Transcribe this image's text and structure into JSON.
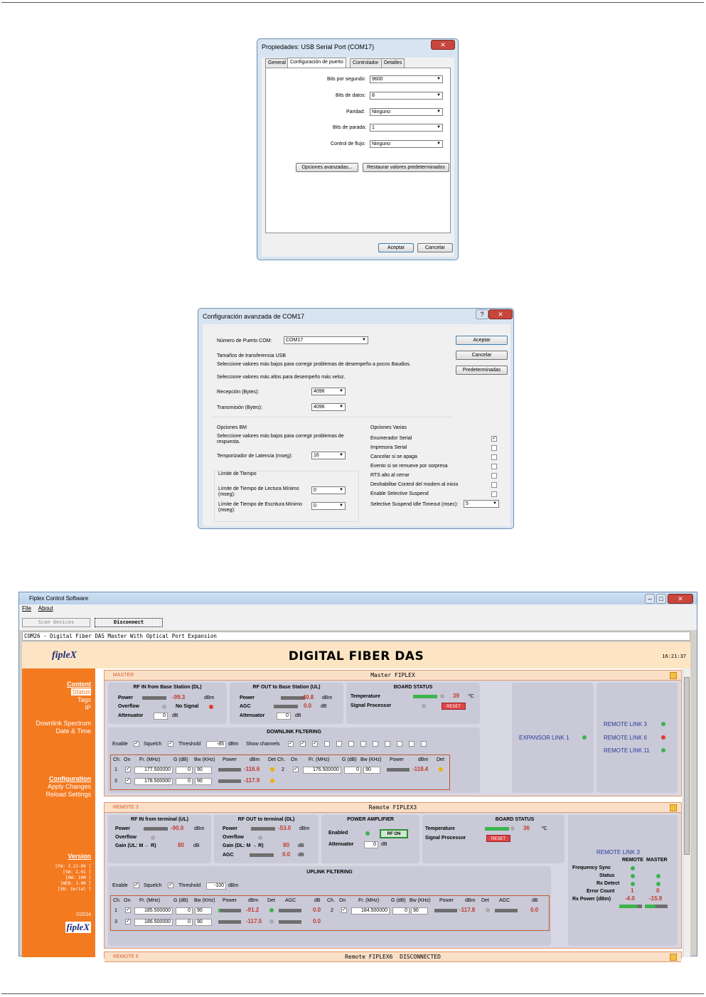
{
  "dialog1": {
    "title": "Propiedades: USB Serial Port (COM17)",
    "tabs": [
      "General",
      "Configuración de puerto",
      "Controlador",
      "Detalles"
    ],
    "fields": [
      {
        "label": "Bits por segundo:",
        "value": "9600"
      },
      {
        "label": "Bits de datos:",
        "value": "8"
      },
      {
        "label": "Paridad:",
        "value": "Ninguno"
      },
      {
        "label": "Bits de parada:",
        "value": "1"
      },
      {
        "label": "Control de flujo:",
        "value": "Ninguno"
      }
    ],
    "advanced_button": "Opciones avanzadas...",
    "restore_button": "Restaurar valores predeterminados",
    "accept_button": "Aceptar",
    "cancel_button": "Cancelar"
  },
  "dialog2": {
    "title": "Configuración avanzada de COM17",
    "com_label": "Número de Puerto COM:",
    "com_value": "COM17",
    "usb_group": "Tamaños de transferencia USB",
    "usb_note1": "Seleccione valores más bajos para corregir problemas de desempeño a pocos Baudios.",
    "usb_note2": "Seleccione valores más altos para desempeño más veloz.",
    "rx_label": "Recepción (Bytes):",
    "rx_value": "4096",
    "tx_label": "Transmisión (Bytes):",
    "tx_value": "4096",
    "bm_group": "Opciones BM",
    "bm_note": "Seleccione valores más bajos para corregir problemas de respuesta.",
    "latency_label": "Temporizador de Latencia (mseg):",
    "latency_value": "16",
    "timeouts_group": "Límite de Tiempo",
    "read_timeout_label": "Límite de Tiempo de Lectura Mínimo (mseg):",
    "read_timeout_value": "0",
    "write_timeout_label": "Límite de Tiempo de Escritura Mínimo (mseg):",
    "write_timeout_value": "0",
    "misc_group": "Opciones Varias",
    "misc_options": [
      {
        "label": "Enumerador Serial",
        "checked": "✓"
      },
      {
        "label": "Impresora Serial",
        "checked": ""
      },
      {
        "label": "Cancelar si se apaga",
        "checked": ""
      },
      {
        "label": "Evento si se remueve por sorpresa",
        "checked": ""
      },
      {
        "label": "RTS alto al cerrar",
        "checked": ""
      },
      {
        "label": "Deshabilitar Control del modem al inicio",
        "checked": ""
      },
      {
        "label": "Enable Selective Suspend",
        "checked": ""
      }
    ],
    "suspend_label": "Selective Suspend Idle Timeout (msec):",
    "suspend_value": "5",
    "accept_button": "Aceptar",
    "cancel_button": "Cancelar",
    "defaults_button": "Predeterminadas"
  },
  "app": {
    "title": "Fiplex Control Software",
    "menu": [
      "File",
      "About"
    ],
    "scan_button": "Scan devices",
    "disconnect_button": "Disconnect",
    "device": "COM26 - Digital Fiber DAS Master With Optical Port Expansion",
    "logo": "fipleX",
    "heading": "DIGITAL FIBER DAS",
    "clock": "16:21:37",
    "sidebar": {
      "content": "Content",
      "status": "Status",
      "tags": "Tags",
      "ip": "IP",
      "spectrum": "Downlink Spectrum",
      "datetime": "Date & Time",
      "configuration": "Configuration",
      "apply": "Apply Changes",
      "reload": "Reload Settings",
      "version": "Version",
      "fw": "[FW: 3.12-00 ]",
      "sw": "[SW: 2.01 ]",
      "hw": "[HW: 10M ]",
      "web": "[WEB: 1.00 ]",
      "sn": "[SN: Serial ]",
      "copyright": "©2014"
    },
    "master": {
      "tag": "MASTER",
      "title": "Master FIPLEX",
      "rfin_title": "RF IN from Base Station (DL)",
      "rfin_power_label": "Power",
      "rfin_power": "-99.3",
      "dbm": "dBm",
      "db": "dB",
      "overflow_label": "Overflow",
      "nosignal_label": "No Signal",
      "attenuator_label": "Attenuator",
      "attenuator_value": "0",
      "rfout_title": "RF OUT to Base Station (UL)",
      "rfout_power": "-40.8",
      "agc_label": "AGC",
      "agc_value": "0.0",
      "rfout_att": "0",
      "board_title": "BOARD STATUS",
      "temp_label": "Temperature",
      "temp_value": "39",
      "temp_unit": "ºC",
      "sp_label": "Signal Processor",
      "reset": "RESET",
      "dlf_title": "DOWNLINK FILTERING",
      "enable_label": "Enable",
      "squelch_label": "Squelch",
      "threshold_label": "Threshold",
      "threshold_value": "-85",
      "showch_label": "Show channels",
      "col_headers": [
        "Ch.",
        "On",
        "Fr. (MHz)",
        "G (dB)",
        "Bw (KHz)",
        "Power",
        "dBm",
        "Det"
      ],
      "channels": [
        {
          "ch": "1",
          "fr": "177.500000",
          "g": "0",
          "bw": "90",
          "p": "-116.6"
        },
        {
          "ch": "2",
          "fr": "176.500000",
          "g": "0",
          "bw": "90",
          "p": "-118.4"
        },
        {
          "ch": "3",
          "fr": "178.500000",
          "g": "0",
          "bw": "90",
          "p": "-117.9"
        }
      ],
      "expansor": "EXPANSOR LINK 1",
      "remote_links": [
        "REMOTE LINK 3",
        "REMOTE LINK 6",
        "REMOTE LINK 11"
      ]
    },
    "remote3": {
      "tag": "REMOTE 3",
      "title": "Remote FIPLEX3",
      "rfin_title": "RF IN from terminal (UL)",
      "power": "-90.0",
      "overflow": "Overflow",
      "gain_label": "Gain (UL: M ← R)",
      "gain": "80",
      "rfout_title": "RF OUT to terminal (DL)",
      "rfout_power": "-53.0",
      "gain2_label": "Gain (DL: M → R)",
      "gain2": "80",
      "agc": "0.0",
      "pa_title": "POWER AMPLIFIER",
      "enabled_label": "Enabled",
      "rf_on": "RF ON",
      "att_value": "0",
      "board_title": "BOARD STATUS",
      "temp": "36",
      "ulf_title": "UPLINK FILTERING",
      "threshold": "-100",
      "col_headers": [
        "Ch.",
        "On",
        "Fr. (MHz)",
        "G (dB)",
        "Bw (KHz)",
        "Power",
        "dBm",
        "Det",
        "AGC",
        "dB"
      ],
      "channels": [
        {
          "ch": "1",
          "fr": "185.500000",
          "g": "0",
          "bw": "90",
          "p": "-91.2",
          "agc": "0.0"
        },
        {
          "ch": "2",
          "fr": "184.500000",
          "g": "0",
          "bw": "90",
          "p": "-117.8",
          "agc": "0.0"
        },
        {
          "ch": "3",
          "fr": "186.500000",
          "g": "0",
          "bw": "90",
          "p": "-117.5",
          "agc": "0.0"
        }
      ],
      "link_title": "REMOTE LINK 3",
      "remote_col": "REMOTE",
      "master_col": "MASTER",
      "freq_sync": "Frequency Sync",
      "status": "Status",
      "rx_detect": "Rx Detect",
      "error_count": "Error Count",
      "err_remote": "1",
      "err_master": "0",
      "rx_power": "Rx Power (dBm)",
      "rx_remote": "-4.0",
      "rx_master": "-15.9"
    },
    "remote6": {
      "tag": "REMOTE 6",
      "title": "Remote FIPLEX6  DISCONNECTED"
    }
  }
}
